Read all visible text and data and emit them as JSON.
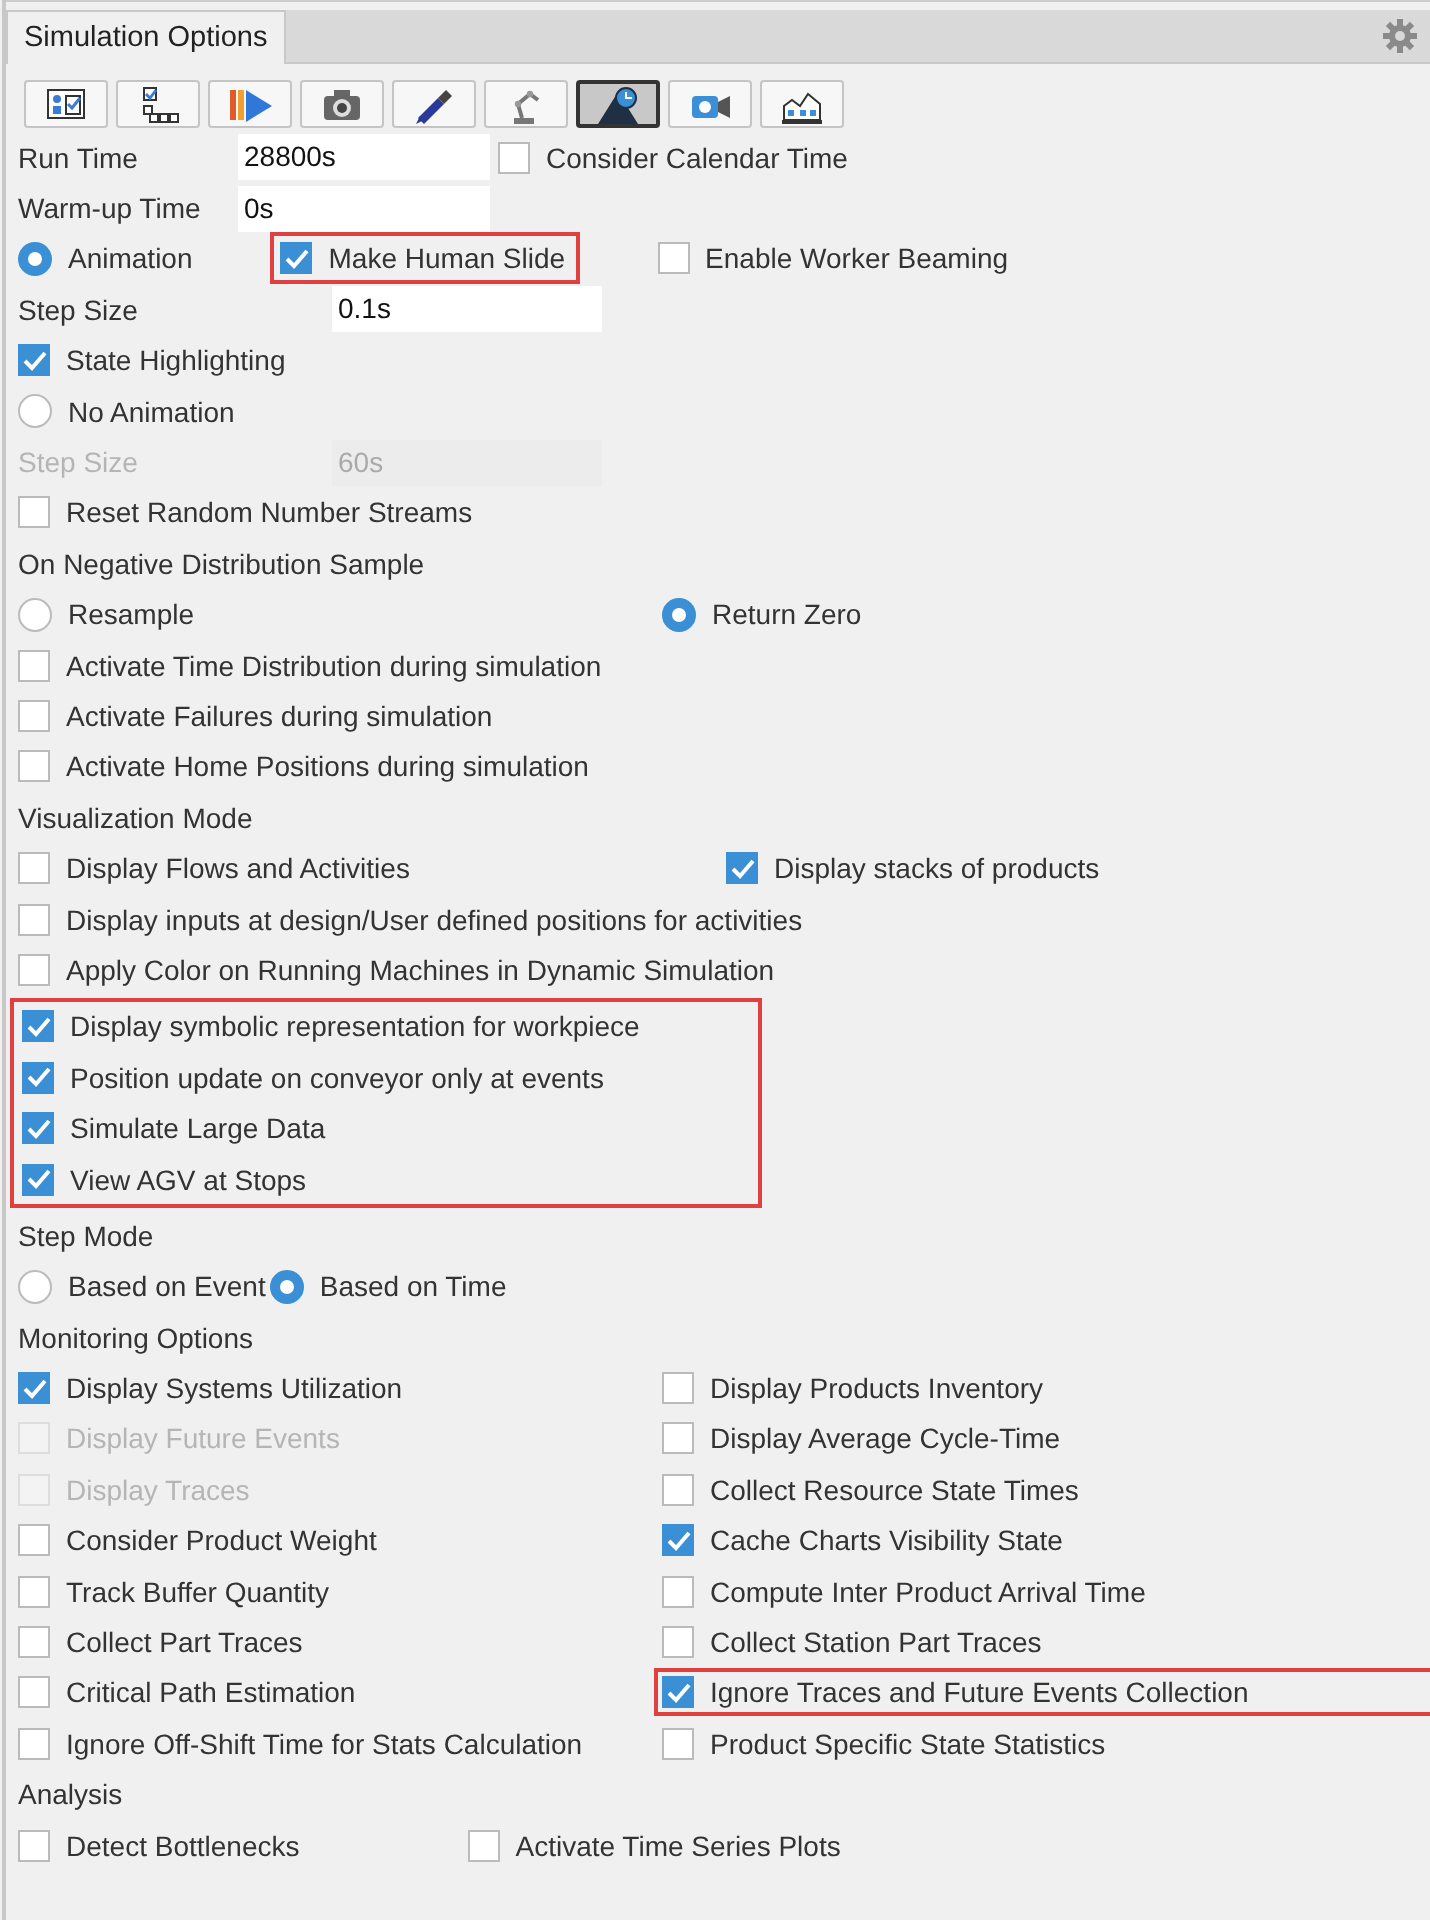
{
  "panel": {
    "tab": "Simulation Options"
  },
  "toolbar": [
    {
      "selected": false
    },
    {
      "selected": false
    },
    {
      "selected": false
    },
    {
      "selected": false
    },
    {
      "selected": false
    },
    {
      "selected": false
    },
    {
      "selected": true
    },
    {
      "selected": false
    },
    {
      "selected": false
    }
  ],
  "rows": [
    {
      "kind": "form",
      "items": [
        {
          "kind": "label",
          "text": "Run Time",
          "disabled": false
        },
        {
          "kind": "field",
          "value": "28800s",
          "disabled": false
        },
        {
          "kind": "check",
          "text": "Consider Calendar Time",
          "checked": false,
          "disabled": false
        }
      ]
    },
    {
      "kind": "form",
      "items": [
        {
          "kind": "label",
          "text": "Warm-up Time",
          "disabled": false
        },
        {
          "kind": "field",
          "value": "0s",
          "disabled": false
        }
      ]
    },
    {
      "kind": "flow",
      "items": [
        {
          "kind": "radio",
          "text": "Animation",
          "selected": true
        },
        {
          "kind": "check",
          "text": "Make Human Slide",
          "checked": true,
          "disabled": false,
          "highlighted": true
        },
        {
          "kind": "check",
          "text": "Enable Worker Beaming",
          "checked": false,
          "disabled": false
        }
      ]
    },
    {
      "kind": "form-step",
      "items": [
        {
          "kind": "label",
          "text": "Step Size",
          "disabled": false
        },
        {
          "kind": "field",
          "value": "0.1s",
          "disabled": false
        }
      ]
    },
    {
      "kind": "flow",
      "items": [
        {
          "kind": "check",
          "text": "State Highlighting",
          "checked": true,
          "disabled": false
        }
      ]
    },
    {
      "kind": "flow",
      "items": [
        {
          "kind": "radio",
          "text": "No Animation",
          "selected": false
        }
      ]
    },
    {
      "kind": "form-step",
      "items": [
        {
          "kind": "label",
          "text": "Step Size",
          "disabled": true
        },
        {
          "kind": "field",
          "value": "60s",
          "disabled": true
        }
      ]
    },
    {
      "kind": "flow",
      "items": [
        {
          "kind": "check",
          "text": "Reset Random Number Streams",
          "checked": false,
          "disabled": false
        }
      ]
    },
    {
      "kind": "flow",
      "items": [
        {
          "kind": "label",
          "text": "On Negative Distribution Sample",
          "disabled": false
        }
      ]
    },
    {
      "kind": "pair",
      "items": [
        {
          "kind": "radio",
          "text": "Resample",
          "selected": false
        },
        {
          "kind": "radio",
          "text": "Return Zero",
          "selected": true
        }
      ]
    },
    {
      "kind": "flow",
      "items": [
        {
          "kind": "check",
          "text": "Activate Time Distribution during simulation",
          "checked": false,
          "disabled": false
        }
      ]
    },
    {
      "kind": "flow",
      "items": [
        {
          "kind": "check",
          "text": "Activate Failures during simulation",
          "checked": false,
          "disabled": false
        }
      ]
    },
    {
      "kind": "flow",
      "items": [
        {
          "kind": "check",
          "text": "Activate Home Positions during simulation",
          "checked": false,
          "disabled": false
        }
      ]
    },
    {
      "kind": "flow",
      "items": [
        {
          "kind": "label",
          "text": "Visualization Mode",
          "disabled": false
        }
      ]
    },
    {
      "kind": "pair-wide",
      "items": [
        {
          "kind": "check",
          "text": "Display Flows and Activities",
          "checked": false,
          "disabled": false
        },
        {
          "kind": "check",
          "text": "Display stacks of products",
          "checked": true,
          "disabled": false
        }
      ]
    },
    {
      "kind": "flow",
      "items": [
        {
          "kind": "check",
          "text": "Display inputs at design/User defined positions for activities",
          "checked": false,
          "disabled": false
        }
      ]
    },
    {
      "kind": "flow",
      "items": [
        {
          "kind": "check",
          "text": "Apply Color on Running Machines in Dynamic Simulation",
          "checked": false,
          "disabled": false
        }
      ]
    },
    {
      "kind": "group",
      "highlighted": true,
      "rows": [
        {
          "kind": "flow",
          "items": [
            {
              "kind": "check",
              "text": "Display symbolic representation for workpiece",
              "checked": true,
              "disabled": false
            }
          ]
        },
        {
          "kind": "flow",
          "items": [
            {
              "kind": "check",
              "text": "Position update on conveyor only at events",
              "checked": true,
              "disabled": false
            }
          ]
        },
        {
          "kind": "flow",
          "items": [
            {
              "kind": "check",
              "text": "Simulate Large Data",
              "checked": true,
              "disabled": false
            }
          ]
        },
        {
          "kind": "flow",
          "items": [
            {
              "kind": "check",
              "text": "View AGV at Stops",
              "checked": true,
              "disabled": false
            }
          ]
        }
      ]
    },
    {
      "kind": "flow",
      "items": [
        {
          "kind": "label",
          "text": "Step Mode",
          "disabled": false
        }
      ]
    },
    {
      "kind": "tight",
      "items": [
        {
          "kind": "radio",
          "text": "Based on Event",
          "selected": false
        },
        {
          "kind": "radio",
          "text": "Based on Time",
          "selected": true
        }
      ]
    },
    {
      "kind": "flow",
      "items": [
        {
          "kind": "label",
          "text": "Monitoring Options",
          "disabled": false
        }
      ]
    },
    {
      "kind": "pair",
      "items": [
        {
          "kind": "check",
          "text": "Display Systems Utilization",
          "checked": true,
          "disabled": false
        },
        {
          "kind": "check",
          "text": "Display Products Inventory",
          "checked": false,
          "disabled": false
        }
      ]
    },
    {
      "kind": "pair",
      "items": [
        {
          "kind": "check",
          "text": "Display Future Events",
          "checked": false,
          "disabled": true
        },
        {
          "kind": "check",
          "text": "Display Average Cycle-Time",
          "checked": false,
          "disabled": false
        }
      ]
    },
    {
      "kind": "pair",
      "items": [
        {
          "kind": "check",
          "text": "Display Traces",
          "checked": false,
          "disabled": true
        },
        {
          "kind": "check",
          "text": "Collect Resource State Times",
          "checked": false,
          "disabled": false
        }
      ]
    },
    {
      "kind": "pair",
      "items": [
        {
          "kind": "check",
          "text": "Consider Product Weight",
          "checked": false,
          "disabled": false
        },
        {
          "kind": "check",
          "text": "Cache Charts Visibility State",
          "checked": true,
          "disabled": false
        }
      ]
    },
    {
      "kind": "pair",
      "items": [
        {
          "kind": "check",
          "text": "Track Buffer Quantity",
          "checked": false,
          "disabled": false
        },
        {
          "kind": "check",
          "text": "Compute Inter Product Arrival Time",
          "checked": false,
          "disabled": false
        }
      ]
    },
    {
      "kind": "pair",
      "items": [
        {
          "kind": "check",
          "text": "Collect Part Traces",
          "checked": false,
          "disabled": false
        },
        {
          "kind": "check",
          "text": "Collect Station Part Traces",
          "checked": false,
          "disabled": false
        }
      ]
    },
    {
      "kind": "pair",
      "items": [
        {
          "kind": "check",
          "text": "Critical Path Estimation",
          "checked": false,
          "disabled": false
        },
        {
          "kind": "check",
          "text": "Ignore Traces and Future Events Collection",
          "checked": true,
          "disabled": false,
          "highlighted": true
        }
      ]
    },
    {
      "kind": "pair",
      "items": [
        {
          "kind": "check",
          "text": "Ignore Off-Shift Time for Stats Calculation",
          "checked": false,
          "disabled": false
        },
        {
          "kind": "check",
          "text": "Product Specific State Statistics",
          "checked": false,
          "disabled": false
        }
      ]
    },
    {
      "kind": "flow",
      "items": [
        {
          "kind": "label",
          "text": "Analysis",
          "disabled": false
        }
      ]
    },
    {
      "kind": "flow-wide",
      "items": [
        {
          "kind": "check",
          "text": "Detect Bottlenecks",
          "checked": false,
          "disabled": false
        },
        {
          "kind": "check",
          "text": "Activate Time Series Plots",
          "checked": false,
          "disabled": false
        }
      ]
    }
  ]
}
